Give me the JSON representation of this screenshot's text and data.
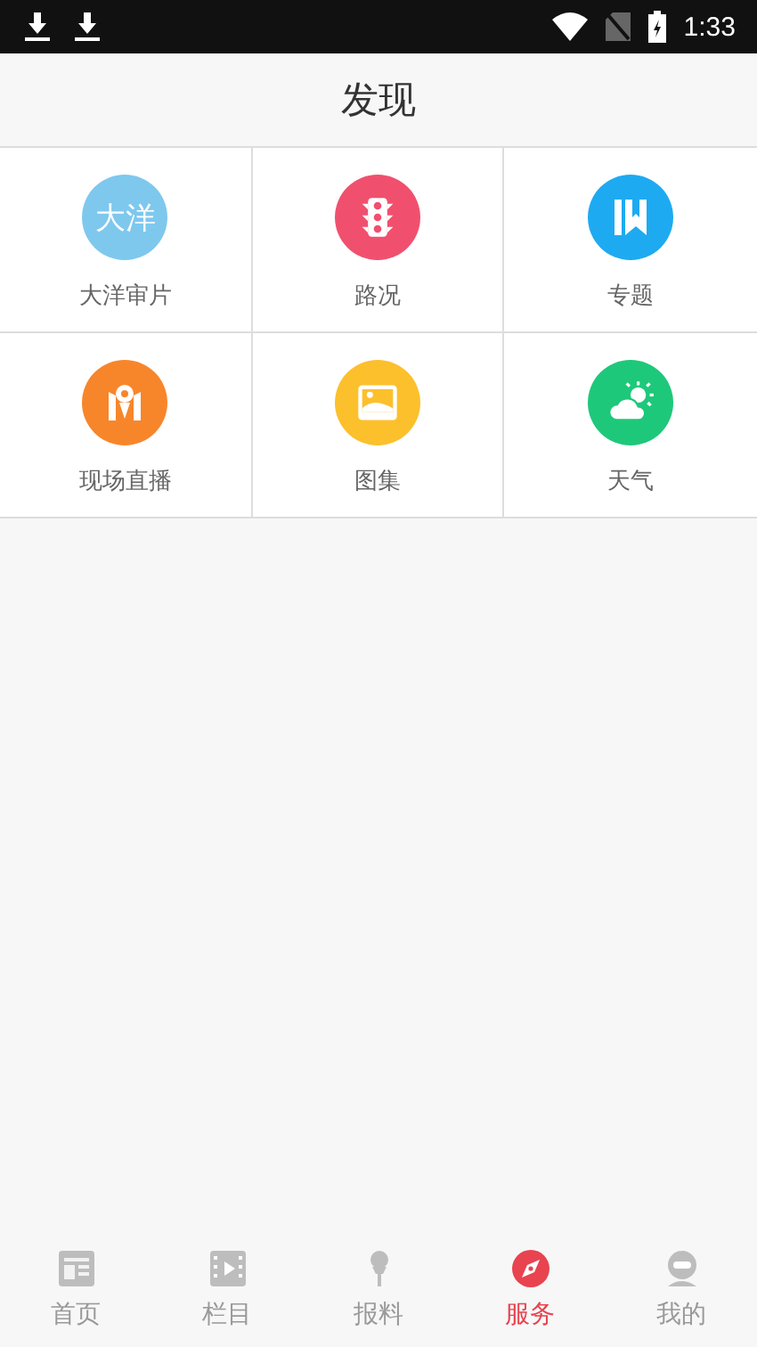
{
  "status_bar": {
    "time": "1:33"
  },
  "header": {
    "title": "发现"
  },
  "grid": [
    {
      "label": "大洋审片",
      "kind": "text",
      "icon_text": "大洋",
      "color": "#7ec8ee"
    },
    {
      "label": "路况",
      "kind": "traffic",
      "color": "#f0506e"
    },
    {
      "label": "专题",
      "kind": "book",
      "color": "#1eaaf1"
    },
    {
      "label": "现场直播",
      "kind": "live",
      "color": "#f7862b"
    },
    {
      "label": "图集",
      "kind": "image",
      "color": "#fcc02c"
    },
    {
      "label": "天气",
      "kind": "weather",
      "color": "#1ec87a"
    }
  ],
  "tabs": [
    {
      "label": "首页",
      "kind": "home",
      "selected": false
    },
    {
      "label": "栏目",
      "kind": "film",
      "selected": false
    },
    {
      "label": "报料",
      "kind": "mic",
      "selected": false
    },
    {
      "label": "服务",
      "kind": "compass",
      "selected": true
    },
    {
      "label": "我的",
      "kind": "user",
      "selected": false
    }
  ]
}
